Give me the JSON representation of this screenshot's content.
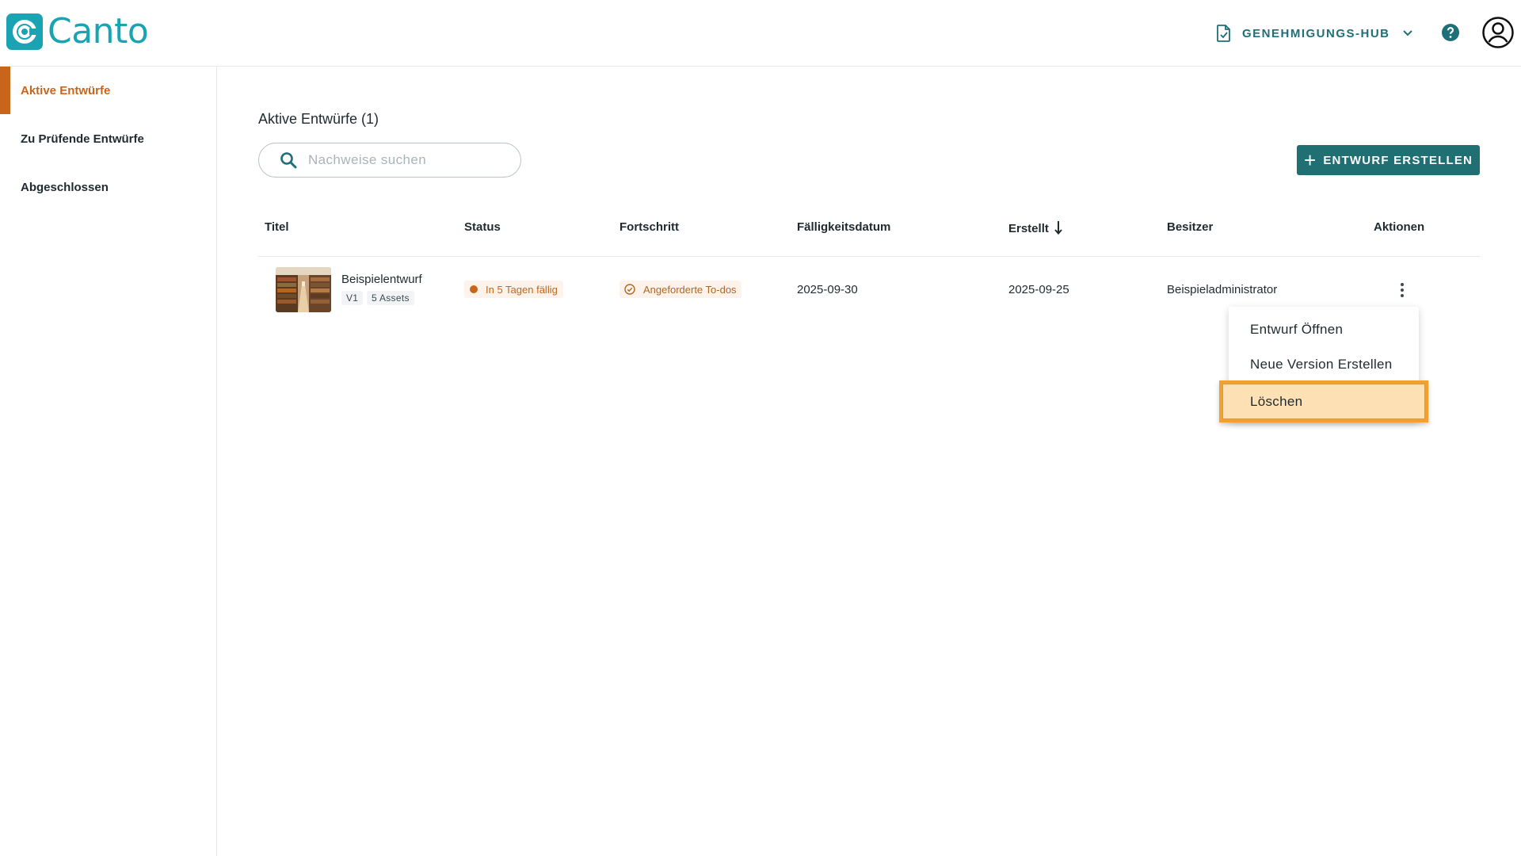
{
  "app": {
    "logo_text": "Canto",
    "brand_color": "#1aa3b3",
    "accent_color": "#c8651b",
    "primary_button_color": "#1f6f73"
  },
  "header": {
    "hub_label": "GENEHMIGUNGS-HUB",
    "hub_icon": "document-check-icon",
    "help_icon": "help-circle-icon",
    "avatar_icon": "user-avatar-icon"
  },
  "sidebar": {
    "items": [
      {
        "label": "Aktive Entwürfe",
        "active": true
      },
      {
        "label": "Zu Prüfende Entwürfe",
        "active": false
      },
      {
        "label": "Abgeschlossen",
        "active": false
      }
    ]
  },
  "main": {
    "title": "Aktive Entwürfe (1)",
    "search_placeholder": "Nachweise suchen",
    "create_button": "ENTWURF ERSTELLEN"
  },
  "table": {
    "headers": {
      "title": "Titel",
      "status": "Status",
      "progress": "Fortschritt",
      "due": "Fälligkeitsdatum",
      "created": "Erstellt",
      "owner": "Besitzer",
      "actions": "Aktionen"
    },
    "sort_column": "created",
    "sort_direction": "descending",
    "rows": [
      {
        "title": "Beispielentwurf",
        "version": "V1",
        "assets": "5 Assets",
        "status": "In 5 Tagen fällig",
        "progress": "Angeforderte To-dos",
        "due": "2025-09-30",
        "created": "2025-09-25",
        "owner": "Beispieladministrator"
      }
    ]
  },
  "context_menu": {
    "items": [
      {
        "label": "Entwurf Öffnen"
      },
      {
        "label": "Neue Version Erstellen"
      },
      {
        "label": "Löschen",
        "highlighted": true
      }
    ]
  }
}
